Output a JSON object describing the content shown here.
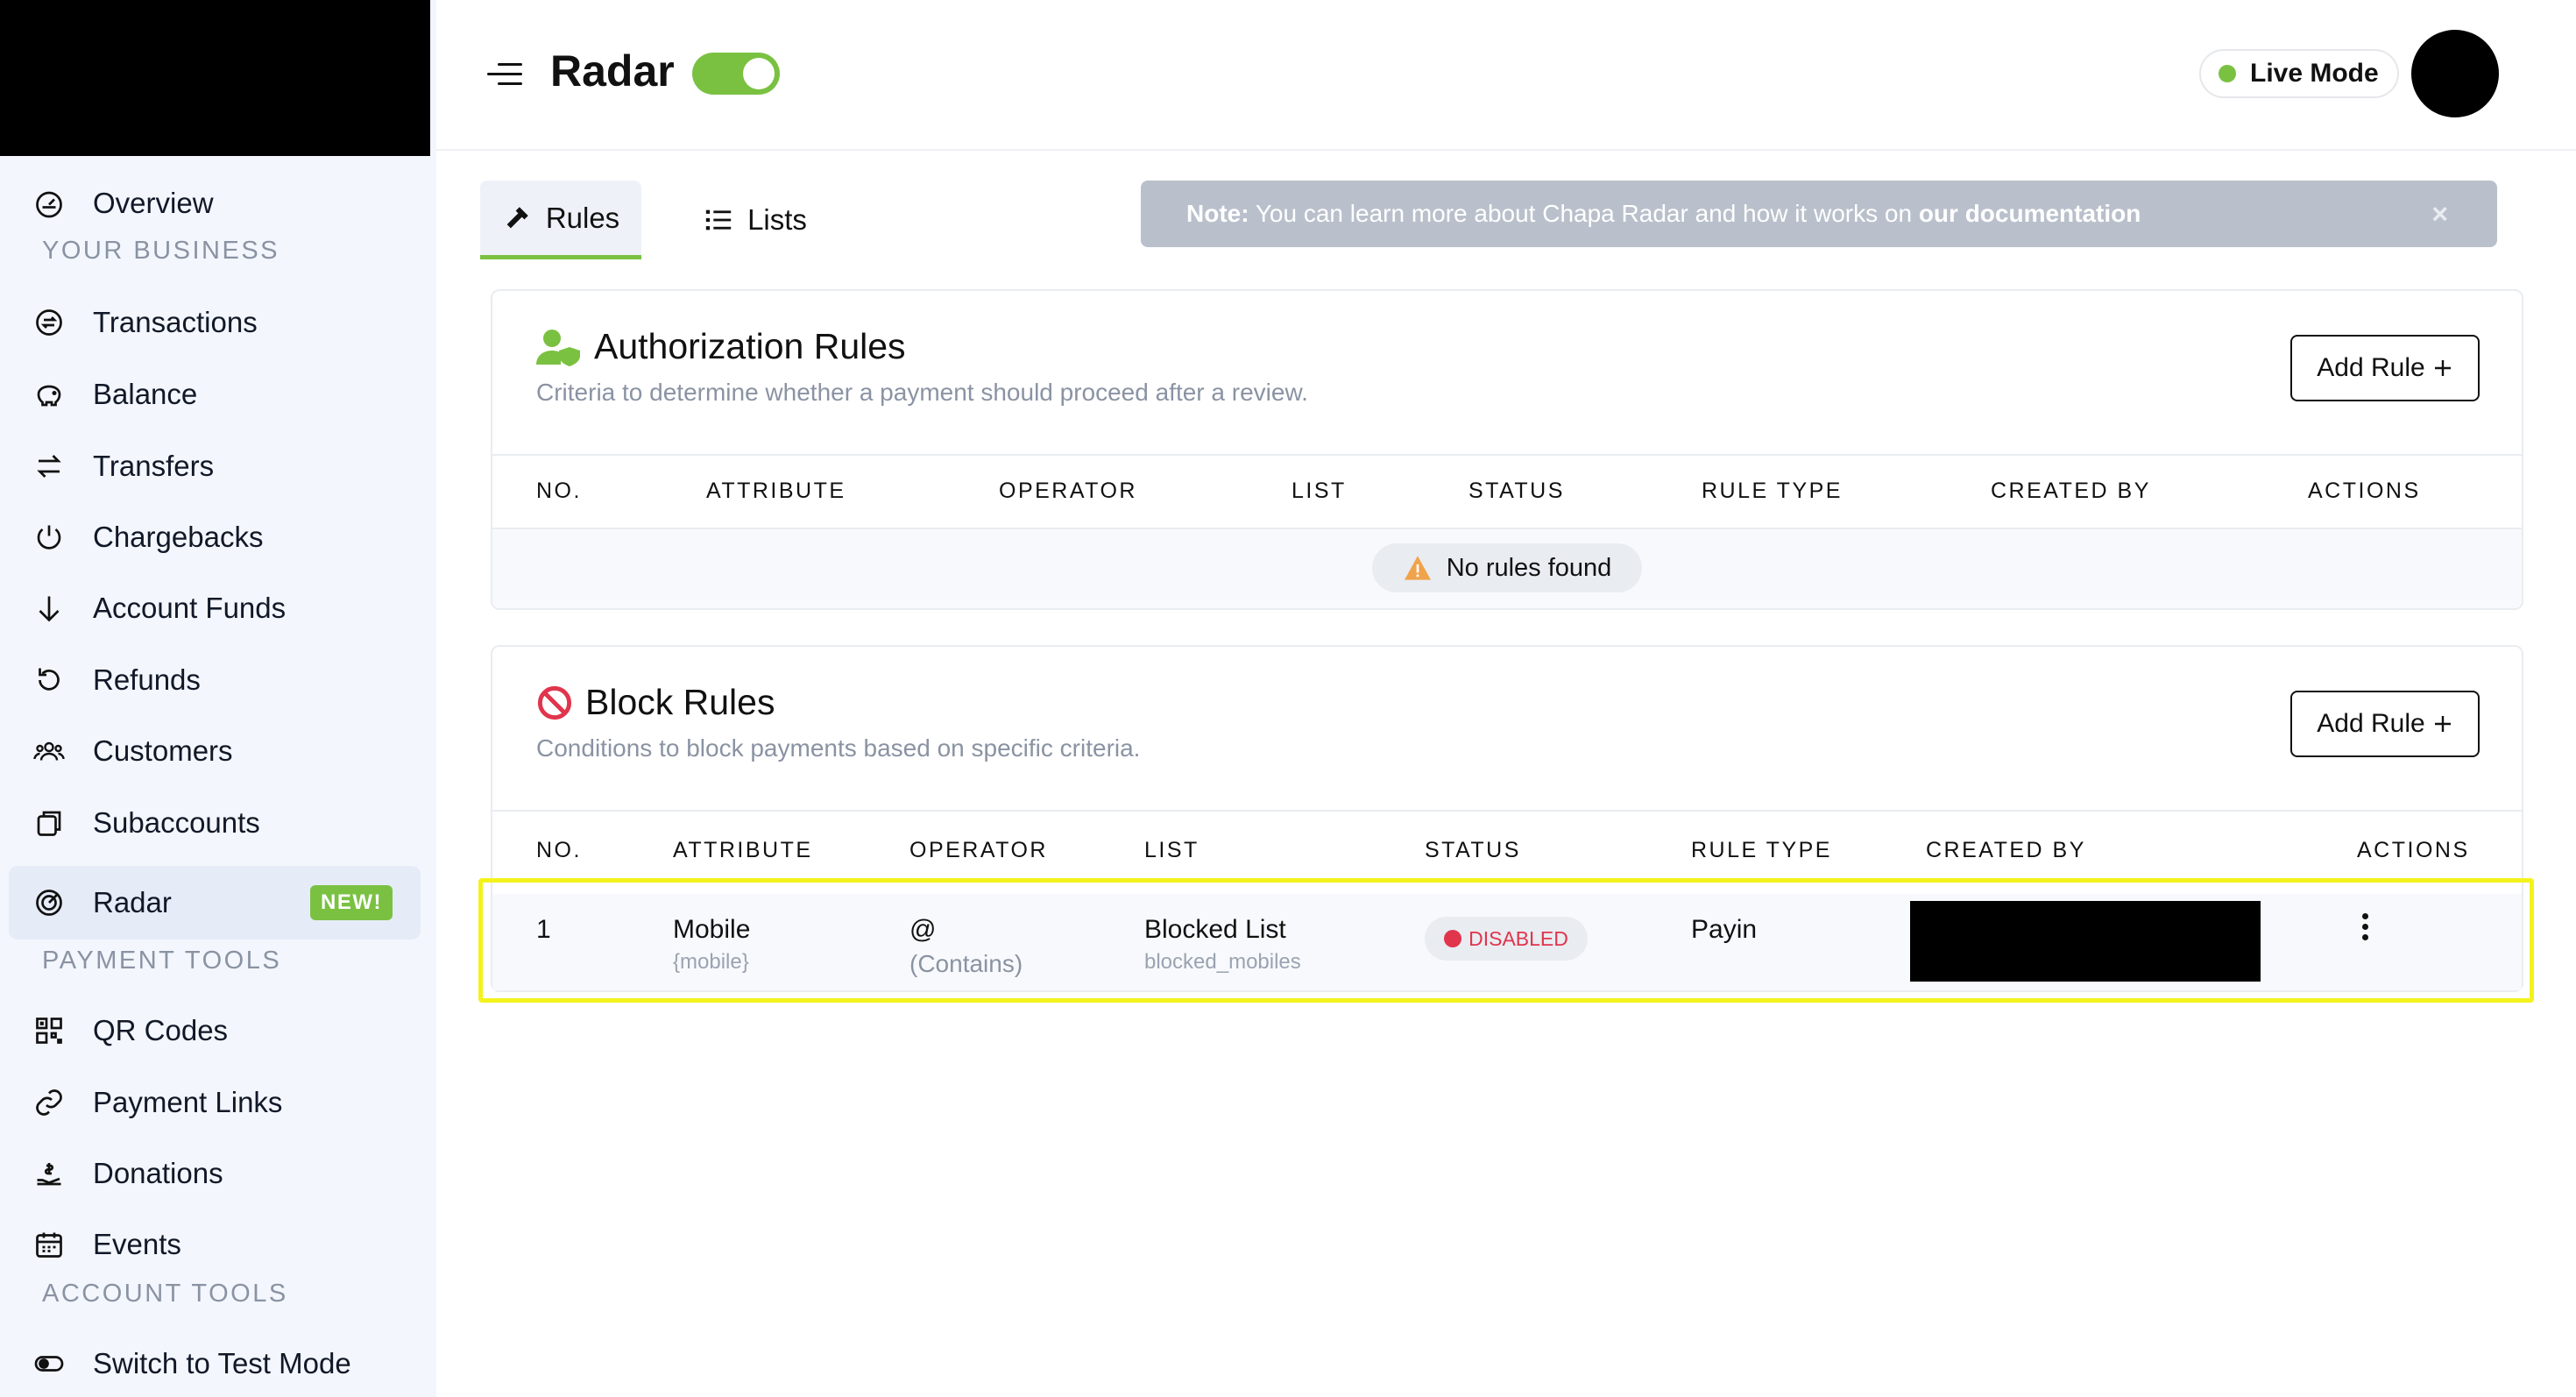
{
  "sidebar": {
    "items": [
      {
        "label": "Overview",
        "icon": "dashboard-icon"
      },
      {
        "label": "Transactions",
        "icon": "transactions-icon"
      },
      {
        "label": "Balance",
        "icon": "piggy-bank-icon"
      },
      {
        "label": "Transfers",
        "icon": "transfer-arrows-icon"
      },
      {
        "label": "Chargebacks",
        "icon": "power-icon"
      },
      {
        "label": "Account Funds",
        "icon": "arrow-down-icon"
      },
      {
        "label": "Refunds",
        "icon": "refund-icon"
      },
      {
        "label": "Customers",
        "icon": "customers-icon"
      },
      {
        "label": "Subaccounts",
        "icon": "subaccounts-icon"
      },
      {
        "label": "Radar",
        "icon": "radar-icon",
        "badge": "NEW!"
      },
      {
        "label": "QR Codes",
        "icon": "qr-code-icon"
      },
      {
        "label": "Payment Links",
        "icon": "link-icon"
      },
      {
        "label": "Donations",
        "icon": "donation-icon"
      },
      {
        "label": "Events",
        "icon": "calendar-icon"
      },
      {
        "label": "Switch to Test Mode",
        "icon": "toggle-icon"
      }
    ],
    "sections": {
      "your_business": "YOUR BUSINESS",
      "payment_tools": "PAYMENT TOOLS",
      "account_tools": "ACCOUNT TOOLS"
    }
  },
  "header": {
    "title": "Radar",
    "live_mode": "Live Mode",
    "accent_color": "#7ac142"
  },
  "tabs": {
    "rules": "Rules",
    "lists": "Lists"
  },
  "note": {
    "label": "Note:",
    "text": " You can learn more about Chapa Radar and how it works on ",
    "link": "our documentation",
    "close": "×"
  },
  "authorization": {
    "title": "Authorization Rules",
    "subtitle": "Criteria to determine whether a payment should proceed after a review.",
    "add_button": "Add Rule",
    "columns": [
      "NO.",
      "ATTRIBUTE",
      "OPERATOR",
      "LIST",
      "STATUS",
      "RULE TYPE",
      "CREATED BY",
      "ACTIONS"
    ],
    "empty": "No rules found"
  },
  "block": {
    "title": "Block Rules",
    "subtitle": "Conditions to block payments based on specific criteria.",
    "add_button": "Add Rule",
    "columns": [
      "NO.",
      "ATTRIBUTE",
      "OPERATOR",
      "LIST",
      "STATUS",
      "RULE TYPE",
      "CREATED BY",
      "ACTIONS"
    ],
    "rows": [
      {
        "no": "1",
        "attribute": "Mobile",
        "attribute_key": "{mobile}",
        "operator": "@",
        "operator_desc": "(Contains)",
        "list": "Blocked List",
        "list_key": "blocked_mobiles",
        "status": "DISABLED",
        "rule_type": "Payin"
      }
    ]
  }
}
